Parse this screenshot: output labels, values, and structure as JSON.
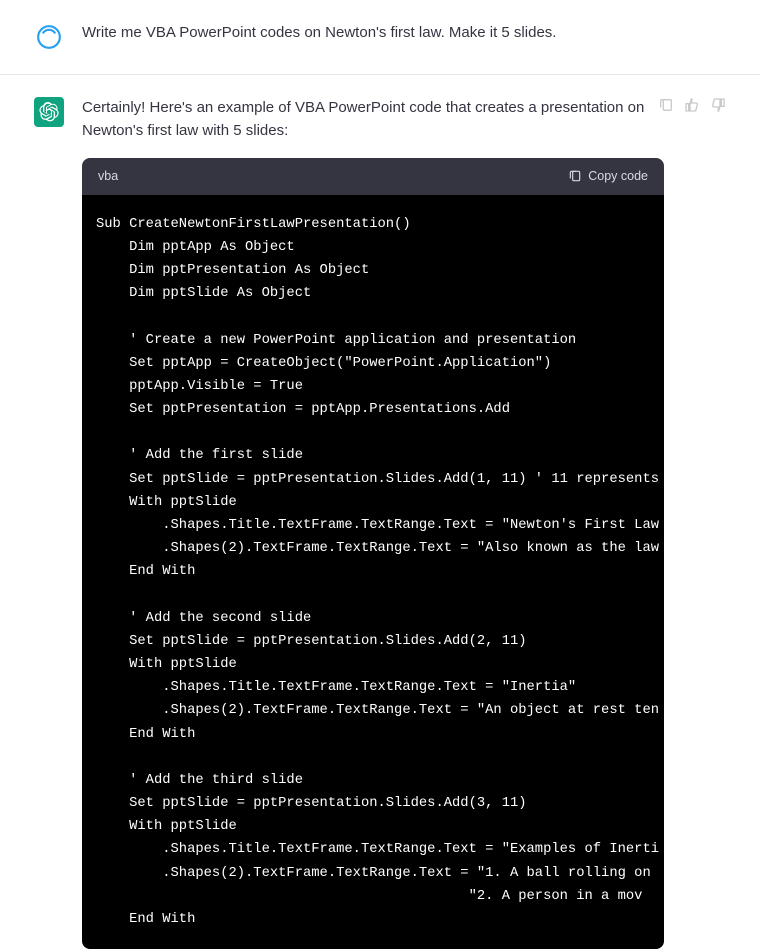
{
  "user_message": {
    "text": "Write me VBA PowerPoint codes on Newton's first law. Make it 5 slides."
  },
  "assistant_message": {
    "intro": "Certainly! Here's an example of VBA PowerPoint code that creates a presentation on Newton's first law with 5 slides:"
  },
  "code_block": {
    "language": "vba",
    "copy_label": "Copy code",
    "code": "Sub CreateNewtonFirstLawPresentation()\n    Dim pptApp As Object\n    Dim pptPresentation As Object\n    Dim pptSlide As Object\n\n    ' Create a new PowerPoint application and presentation\n    Set pptApp = CreateObject(\"PowerPoint.Application\")\n    pptApp.Visible = True\n    Set pptPresentation = pptApp.Presentations.Add\n\n    ' Add the first slide\n    Set pptSlide = pptPresentation.Slides.Add(1, 11) ' 11 represents\n    With pptSlide\n        .Shapes.Title.TextFrame.TextRange.Text = \"Newton's First Law\n        .Shapes(2).TextFrame.TextRange.Text = \"Also known as the law\n    End With\n\n    ' Add the second slide\n    Set pptSlide = pptPresentation.Slides.Add(2, 11)\n    With pptSlide\n        .Shapes.Title.TextFrame.TextRange.Text = \"Inertia\"\n        .Shapes(2).TextFrame.TextRange.Text = \"An object at rest ten\n    End With\n\n    ' Add the third slide\n    Set pptSlide = pptPresentation.Slides.Add(3, 11)\n    With pptSlide\n        .Shapes.Title.TextFrame.TextRange.Text = \"Examples of Inerti\n        .Shapes(2).TextFrame.TextRange.Text = \"1. A ball rolling on \n                                             \"2. A person in a mov\n    End With"
  },
  "icons": {
    "user_avatar": "user-circle-icon",
    "assistant_avatar": "openai-logo-icon",
    "clipboard": "clipboard-icon",
    "thumbs_up": "thumbs-up-icon",
    "thumbs_down": "thumbs-down-icon",
    "copy_clip": "clipboard-icon"
  }
}
